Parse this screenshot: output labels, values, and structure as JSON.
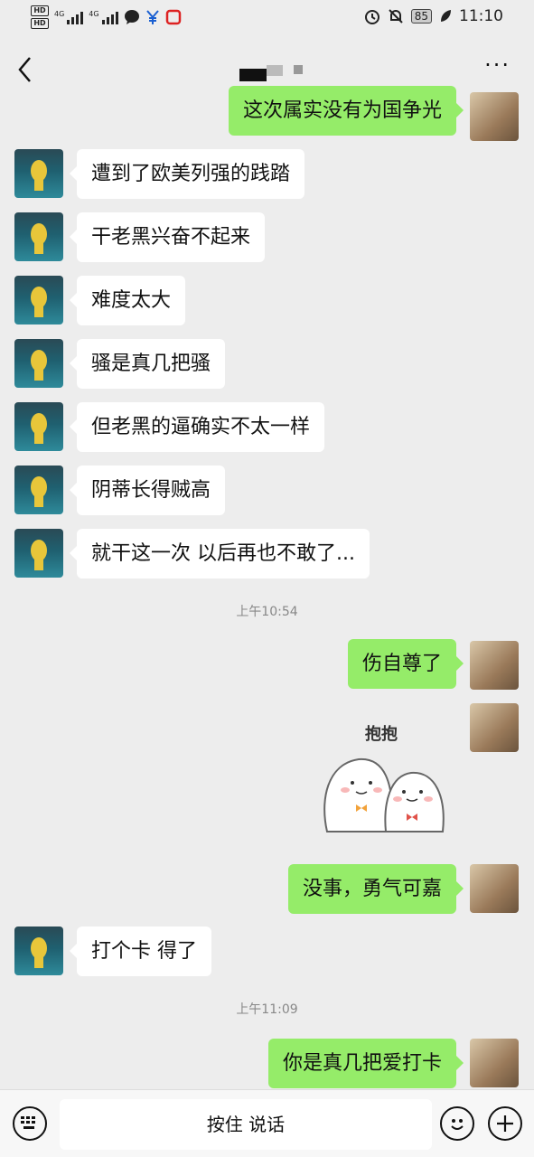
{
  "status_bar": {
    "hd1": "HD",
    "hd2": "HD",
    "net1": "4G",
    "net2": "4G",
    "battery": "85",
    "time": "11:10"
  },
  "header": {
    "back_icon": "chevron-left-icon",
    "more_icon": "ellipsis-icon",
    "more_label": "···"
  },
  "messages": [
    {
      "side": "right",
      "text": "这次属实没有为国争光"
    },
    {
      "side": "left",
      "text": "遭到了欧美列强的践踏"
    },
    {
      "side": "left",
      "text": "干老黑兴奋不起来"
    },
    {
      "side": "left",
      "text": "难度太大"
    },
    {
      "side": "left",
      "text": "骚是真几把骚"
    },
    {
      "side": "left",
      "text": "但老黑的逼确实不太一样"
    },
    {
      "side": "left",
      "text": "阴蒂长得贼高"
    },
    {
      "side": "left",
      "text": "就干这一次 以后再也不敢了..."
    },
    {
      "side": "right",
      "text": "伤自尊了"
    },
    {
      "side": "right",
      "text": "没事，勇气可嘉"
    },
    {
      "side": "left",
      "text": "打个卡 得了"
    },
    {
      "side": "right",
      "text": "你是真几把爱打卡"
    }
  ],
  "timestamps": [
    "上午10:54",
    "上午11:09"
  ],
  "sticker": {
    "caption": "抱抱"
  },
  "input_bar": {
    "hold_to_talk": "按住 说话",
    "keyboard_icon": "keyboard-icon",
    "emoji_icon": "emoji-icon",
    "plus_icon": "plus-icon"
  }
}
